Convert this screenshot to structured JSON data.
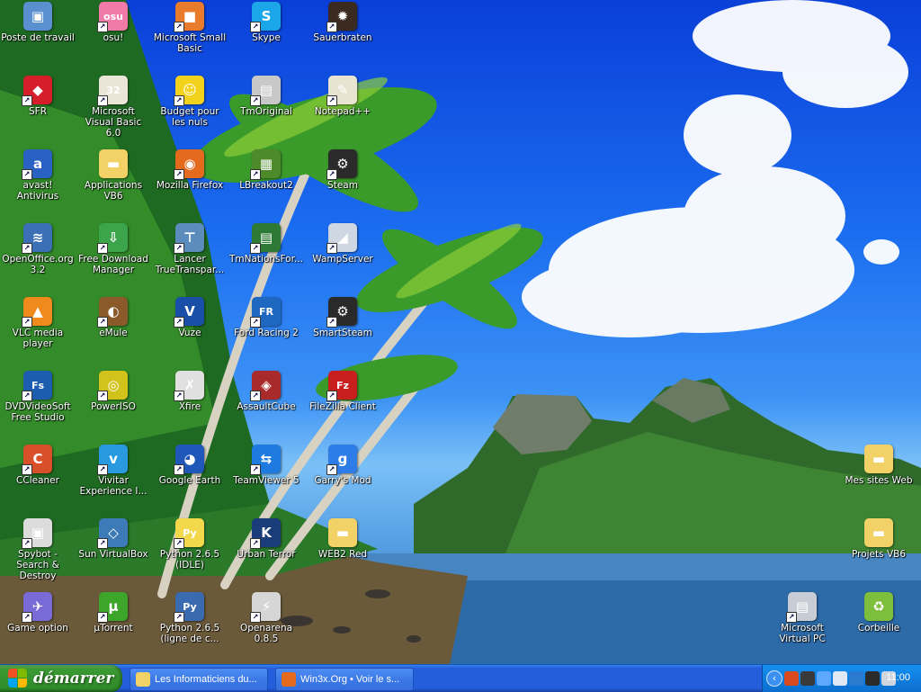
{
  "desktop": {
    "icons": [
      {
        "label": "Poste de travail",
        "icon": "my-computer-icon",
        "shortcut": false,
        "color": "#5a8fd0",
        "glyph": "▣"
      },
      {
        "label": "osu!",
        "icon": "osu-icon",
        "shortcut": true,
        "color": "#f07aa8",
        "glyph": "osu"
      },
      {
        "label": "Microsoft Small Basic",
        "icon": "small-basic-icon",
        "shortcut": true,
        "color": "#e87b2c",
        "glyph": "■"
      },
      {
        "label": "Skype",
        "icon": "skype-icon",
        "shortcut": true,
        "color": "#1aa6e8",
        "glyph": "S"
      },
      {
        "label": "Sauerbraten",
        "icon": "sauerbraten-icon",
        "shortcut": true,
        "color": "#3a2a20",
        "glyph": "✹"
      },
      {
        "label": "SFR",
        "icon": "sfr-icon",
        "shortcut": true,
        "color": "#d61e2a",
        "glyph": "◆"
      },
      {
        "label": "Microsoft Visual Basic 6.0",
        "icon": "visual-basic-icon",
        "shortcut": true,
        "color": "#e9e6d8",
        "glyph": "32"
      },
      {
        "label": "Budget pour les nuls",
        "icon": "budget-icon",
        "shortcut": true,
        "color": "#f2d21c",
        "glyph": "☺"
      },
      {
        "label": "TmOriginal",
        "icon": "tmoriginal-icon",
        "shortcut": true,
        "color": "#c8c8c8",
        "glyph": "▤"
      },
      {
        "label": "Notepad++",
        "icon": "notepad-plus-icon",
        "shortcut": true,
        "color": "#e8e4d2",
        "glyph": "✎"
      },
      {
        "label": "avast! Antivirus",
        "icon": "avast-icon",
        "shortcut": true,
        "color": "#2a62c4",
        "glyph": "a"
      },
      {
        "label": "Applications VB6",
        "icon": "folder-icon",
        "shortcut": false,
        "color": "#f2d266",
        "glyph": "▬"
      },
      {
        "label": "Mozilla Firefox",
        "icon": "firefox-icon",
        "shortcut": true,
        "color": "#e46b1e",
        "glyph": "◉"
      },
      {
        "label": "LBreakout2",
        "icon": "lbreakout-icon",
        "shortcut": true,
        "color": "#4f8a2a",
        "glyph": "▦"
      },
      {
        "label": "Steam",
        "icon": "steam-icon",
        "shortcut": true,
        "color": "#2a2a2a",
        "glyph": "⚙"
      },
      {
        "label": "OpenOffice.org 3.2",
        "icon": "openoffice-icon",
        "shortcut": true,
        "color": "#3b6fb6",
        "glyph": "≋"
      },
      {
        "label": "Free Download Manager",
        "icon": "fdm-icon",
        "shortcut": true,
        "color": "#3aa54a",
        "glyph": "⇩"
      },
      {
        "label": "Lancer TrueTranspar...",
        "icon": "truetransparency-icon",
        "shortcut": true,
        "color": "#5c8cbc",
        "glyph": "⊤"
      },
      {
        "label": "TmNationsFor...",
        "icon": "tmnations-icon",
        "shortcut": true,
        "color": "#2c7a36",
        "glyph": "▤"
      },
      {
        "label": "WampServer",
        "icon": "wampserver-icon",
        "shortcut": true,
        "color": "#cfd8e2",
        "glyph": "◢"
      },
      {
        "label": "VLC media player",
        "icon": "vlc-icon",
        "shortcut": true,
        "color": "#f08a1c",
        "glyph": "▲"
      },
      {
        "label": "eMule",
        "icon": "emule-icon",
        "shortcut": true,
        "color": "#8a5a2a",
        "glyph": "◐"
      },
      {
        "label": "Vuze",
        "icon": "vuze-icon",
        "shortcut": true,
        "color": "#1a4fa8",
        "glyph": "V"
      },
      {
        "label": "Ford Racing 2",
        "icon": "ford-racing-icon",
        "shortcut": true,
        "color": "#1f68c2",
        "glyph": "FR"
      },
      {
        "label": "SmartSteam",
        "icon": "smartsteam-icon",
        "shortcut": true,
        "color": "#2a2a2a",
        "glyph": "⚙"
      },
      {
        "label": "DVDVideoSoft Free Studio",
        "icon": "dvdvideosoft-icon",
        "shortcut": true,
        "color": "#1c5db0",
        "glyph": "Fs"
      },
      {
        "label": "PowerISO",
        "icon": "poweriso-icon",
        "shortcut": true,
        "color": "#d2c21c",
        "glyph": "◎"
      },
      {
        "label": "Xfire",
        "icon": "xfire-icon",
        "shortcut": true,
        "color": "#e0e0e0",
        "glyph": "✗"
      },
      {
        "label": "AssaultCube",
        "icon": "assaultcube-icon",
        "shortcut": true,
        "color": "#a82a2a",
        "glyph": "◈"
      },
      {
        "label": "FileZilla Client",
        "icon": "filezilla-icon",
        "shortcut": true,
        "color": "#c81e1e",
        "glyph": "Fz"
      },
      {
        "label": "CCleaner",
        "icon": "ccleaner-icon",
        "shortcut": true,
        "color": "#d8502a",
        "glyph": "C"
      },
      {
        "label": "Vivitar Experience I...",
        "icon": "vivitar-icon",
        "shortcut": true,
        "color": "#2a9ae0",
        "glyph": "v"
      },
      {
        "label": "Google Earth",
        "icon": "google-earth-icon",
        "shortcut": true,
        "color": "#1f58b8",
        "glyph": "◕"
      },
      {
        "label": "TeamViewer 5",
        "icon": "teamviewer-icon",
        "shortcut": true,
        "color": "#1f7ae0",
        "glyph": "⇆"
      },
      {
        "label": "Garry's Mod",
        "icon": "garrys-mod-icon",
        "shortcut": true,
        "color": "#2e7ce8",
        "glyph": "g"
      },
      {
        "label": "Spybot - Search & Destroy",
        "icon": "spybot-icon",
        "shortcut": true,
        "color": "#dcdcdc",
        "glyph": "▣"
      },
      {
        "label": "Sun VirtualBox",
        "icon": "virtualbox-icon",
        "shortcut": true,
        "color": "#3c7ab8",
        "glyph": "◇"
      },
      {
        "label": "Python 2.6.5 (IDLE)",
        "icon": "python-idle-icon",
        "shortcut": true,
        "color": "#f2d84a",
        "glyph": "Py"
      },
      {
        "label": "Urban Terror",
        "icon": "urban-terror-icon",
        "shortcut": true,
        "color": "#1a3c78",
        "glyph": "K"
      },
      {
        "label": "WEB2 Red",
        "icon": "folder-icon",
        "shortcut": false,
        "color": "#f2d266",
        "glyph": "▬"
      },
      {
        "label": "Game option",
        "icon": "game-option-icon",
        "shortcut": true,
        "color": "#7a6ad8",
        "glyph": "✈"
      },
      {
        "label": "µTorrent",
        "icon": "utorrent-icon",
        "shortcut": true,
        "color": "#3ca52a",
        "glyph": "µ"
      },
      {
        "label": "Python 2.6.5 (ligne de c...",
        "icon": "python-icon",
        "shortcut": true,
        "color": "#3a6ab0",
        "glyph": "Py"
      },
      {
        "label": "Openarena 0.8.5",
        "icon": "openarena-icon",
        "shortcut": true,
        "color": "#d6d6d6",
        "glyph": "⚡"
      },
      {
        "label": "Mes sites Web",
        "icon": "folder-icon",
        "shortcut": false,
        "color": "#f2d266",
        "glyph": "▬"
      },
      {
        "label": "Projets VB6",
        "icon": "folder-icon",
        "shortcut": false,
        "color": "#f2d266",
        "glyph": "▬"
      },
      {
        "label": "Microsoft Virtual PC",
        "icon": "virtual-pc-icon",
        "shortcut": true,
        "color": "#c8ccd4",
        "glyph": "▤"
      },
      {
        "label": "Corbeille",
        "icon": "recycle-bin-icon",
        "shortcut": false,
        "color": "#7dbf3c",
        "glyph": "♻"
      }
    ]
  },
  "taskbar": {
    "start_label": "démarrer",
    "tasks": [
      {
        "label": "Les Informaticiens du...",
        "icon": "folder-icon",
        "color": "#f2d266"
      },
      {
        "label": "Win3x.Org • Voir le s...",
        "icon": "firefox-icon",
        "color": "#e46b1e"
      }
    ],
    "tray_icons": [
      {
        "name": "tray-app-icon-1",
        "color": "#d84a1e"
      },
      {
        "name": "tray-app-icon-2",
        "color": "#3a3a3a"
      },
      {
        "name": "tray-network-icon",
        "color": "#5fa8ff"
      },
      {
        "name": "tray-app-icon-3",
        "color": "#dfe8f4"
      },
      {
        "name": "tray-app-icon-4",
        "color": "#2a7ad0"
      },
      {
        "name": "tray-steam-icon",
        "color": "#2a2a2a"
      },
      {
        "name": "tray-volume-icon",
        "color": "#cfd6e0"
      }
    ],
    "clock": "11:00"
  }
}
